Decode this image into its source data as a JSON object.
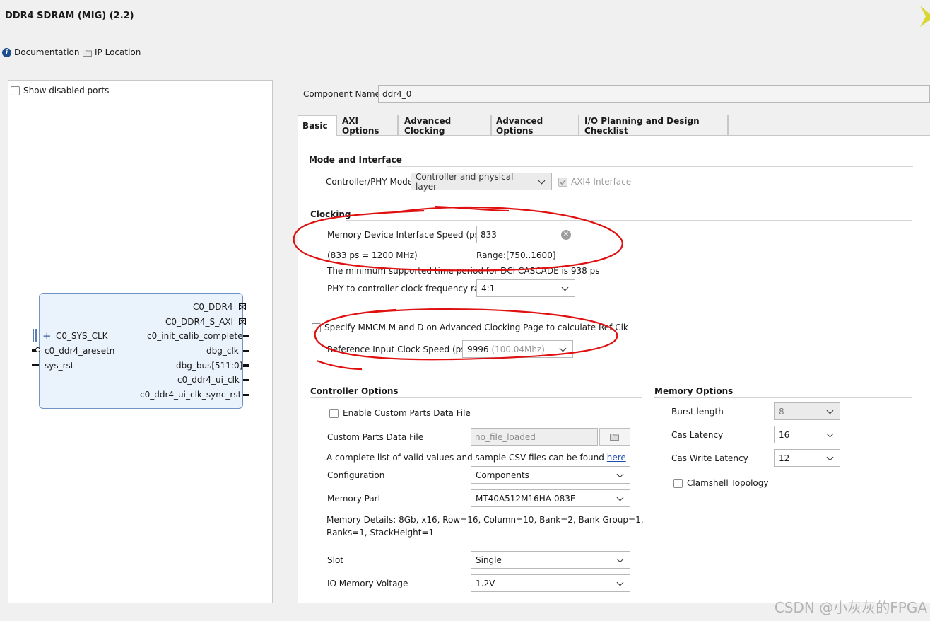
{
  "window": {
    "title": "DDR4 SDRAM (MIG) (2.2)"
  },
  "toolbar": {
    "documentation": "Documentation",
    "ip_location": "IP Location"
  },
  "left_panel": {
    "show_disabled_ports": "Show disabled ports",
    "block": {
      "right_ports": [
        "C0_DDR4",
        "C0_DDR4_S_AXI",
        "c0_init_calib_complete",
        "dbg_clk",
        "dbg_bus[511:0]",
        "c0_ddr4_ui_clk",
        "c0_ddr4_ui_clk_sync_rst"
      ],
      "left_ports": [
        "C0_SYS_CLK",
        "c0_ddr4_aresetn",
        "sys_rst"
      ]
    }
  },
  "component": {
    "label": "Component Name",
    "value": "ddr4_0"
  },
  "tabs": [
    "Basic",
    "AXI Options",
    "Advanced Clocking",
    "Advanced Options",
    "I/O Planning and Design Checklist"
  ],
  "mode": {
    "section": "Mode and Interface",
    "controller_phy_label": "Controller/PHY Mode",
    "controller_phy_value": "Controller and physical layer",
    "axi4_label": "AXI4 Interface"
  },
  "clocking": {
    "section": "Clocking",
    "speed_label": "Memory Device Interface Speed (ps)",
    "speed_value": "833",
    "speed_note": "(833 ps = 1200 MHz)",
    "range": "Range:[750..1600]",
    "min_period_note": "The minimum supported time period for DCI CASCADE is 938 ps",
    "ratio_label": "PHY to controller clock frequency ratio",
    "ratio_value": "4:1",
    "mmcm_label": "Specify MMCM M and D on Advanced Clocking Page to calculate Ref Clk",
    "ref_label": "Reference Input Clock Speed (ps)",
    "ref_value": "9996",
    "ref_hint": "(100.04Mhz)"
  },
  "controller_options": {
    "section": "Controller Options",
    "enable_custom": "Enable Custom Parts Data File",
    "custom_file_label": "Custom Parts Data File",
    "custom_file_value": "no_file_loaded",
    "csv_note": "A complete list of valid values and sample CSV files can be found",
    "csv_link": "here",
    "configuration_label": "Configuration",
    "configuration_value": "Components",
    "memory_part_label": "Memory Part",
    "memory_part_value": "MT40A512M16HA-083E",
    "memory_details_1": "Memory Details: 8Gb, x16, Row=16, Column=10, Bank=2, Bank Group=1,",
    "memory_details_2": "Ranks=1, StackHeight=1",
    "slot_label": "Slot",
    "slot_value": "Single",
    "io_voltage_label": "IO Memory Voltage",
    "io_voltage_value": "1.2V"
  },
  "memory_options": {
    "section": "Memory Options",
    "burst_label": "Burst length",
    "burst_value": "8",
    "cas_label": "Cas Latency",
    "cas_value": "16",
    "cas_write_label": "Cas Write Latency",
    "cas_write_value": "12",
    "clamshell_label": "Clamshell Topology"
  },
  "watermark": "CSDN @小灰灰的FPGA",
  "colors": {
    "annotation": "#e01010",
    "link": "#1b4fb0",
    "block_fill": "#eaf2fb",
    "block_border": "#6f93c2"
  }
}
